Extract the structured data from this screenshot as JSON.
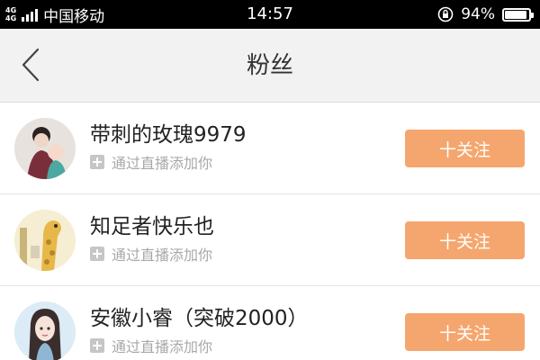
{
  "status_bar": {
    "network": "4G",
    "network_secondary": "4G",
    "carrier": "中国移动",
    "time": "14:57",
    "battery": "94%",
    "battery_level": 0.94
  },
  "nav": {
    "title": "粉丝",
    "back_icon": "chevron-left-icon"
  },
  "fans": [
    {
      "name": "带刺的玫瑰9979",
      "source": "通过直播添加你",
      "button": "十关注"
    },
    {
      "name": "知足者快乐也",
      "source": "通过直播添加你",
      "button": "十关注"
    },
    {
      "name": "安徽小睿（突破2000）",
      "source": "通过直播添加你",
      "button": "十关注"
    }
  ],
  "colors": {
    "accent": "#f5a66e",
    "nav_bg": "#f2f2f2",
    "status_bg": "#000000",
    "secondary_text": "#a8a8a8"
  }
}
